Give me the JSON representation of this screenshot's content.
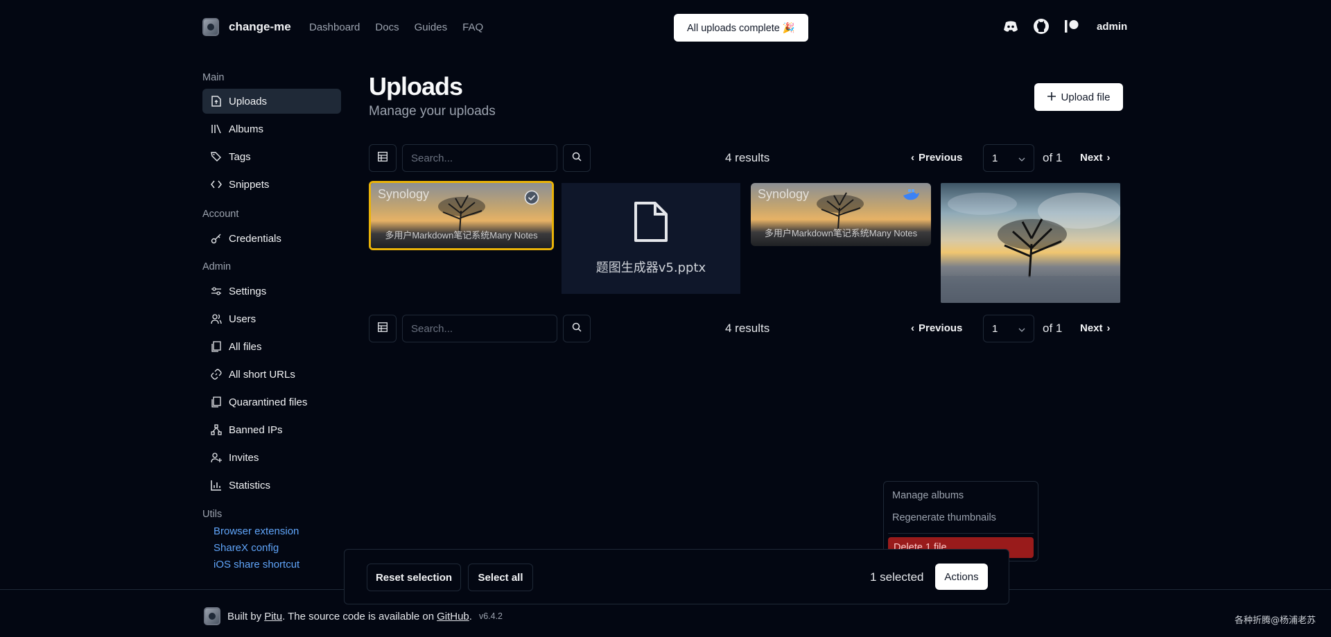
{
  "header": {
    "brand": "change-me",
    "nav": [
      "Dashboard",
      "Docs",
      "Guides",
      "FAQ"
    ],
    "toast": "All uploads complete 🎉",
    "user": "admin"
  },
  "sidebar": {
    "main_label": "Main",
    "main": [
      "Uploads",
      "Albums",
      "Tags",
      "Snippets"
    ],
    "account_label": "Account",
    "account": [
      "Credentials"
    ],
    "admin_label": "Admin",
    "admin": [
      "Settings",
      "Users",
      "All files",
      "All short URLs",
      "Quarantined files",
      "Banned IPs",
      "Invites",
      "Statistics"
    ],
    "utils_label": "Utils",
    "utils": [
      "Browser extension",
      "ShareX config",
      "iOS share shortcut"
    ]
  },
  "page": {
    "title": "Uploads",
    "subtitle": "Manage your uploads",
    "upload_label": "Upload file"
  },
  "toolbar": {
    "search_placeholder": "Search...",
    "results": "4 results",
    "previous": "Previous",
    "page": "1",
    "of": "of 1",
    "next": "Next"
  },
  "grid": {
    "photo_watermark": "Synology",
    "photo_caption": "多用户Markdown笔记系统Many Notes",
    "file_name": "题图生成器v5.pptx"
  },
  "actionbar": {
    "reset": "Reset selection",
    "select_all": "Select all",
    "selected": "1 selected",
    "actions": "Actions"
  },
  "menu": {
    "manage_albums": "Manage albums",
    "regenerate": "Regenerate thumbnails",
    "delete": "Delete 1 file"
  },
  "footer": {
    "built_by": "Built by",
    "author": "Pitu",
    "source": ". The source code is available on",
    "github": "GitHub",
    "version": "v6.4.2",
    "watermark": "各种折腾@杨浦老苏"
  },
  "colors": {
    "background": "#030712",
    "accent_link": "#60a5fa",
    "selected_border": "#eab308",
    "danger": "#991b1b"
  }
}
